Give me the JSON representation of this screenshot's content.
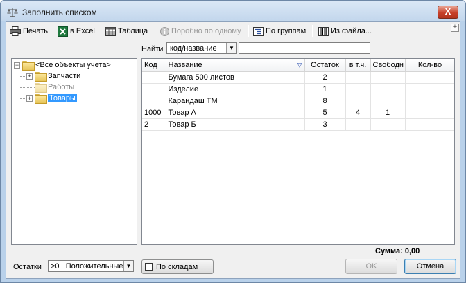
{
  "window": {
    "title": "Заполнить списком",
    "close_glyph": "X"
  },
  "toolbar": {
    "print": "Печать",
    "excel": "в Excel",
    "table": "Таблица",
    "one_by_one": "Поробно по одному",
    "by_groups": "По группам",
    "from_file": "Из файла...",
    "plus_glyph": "+"
  },
  "find": {
    "label": "Найти",
    "mode": "код/название",
    "value": ""
  },
  "tree": {
    "root": "<Все объекты учета>",
    "items": [
      {
        "label": "Запчасти"
      },
      {
        "label": "Работы"
      },
      {
        "label": "Товары"
      }
    ]
  },
  "grid": {
    "columns": [
      "Код",
      "Название",
      "Остаток",
      "в т.ч.",
      "Свободн",
      "Кол-во"
    ],
    "rows": [
      {
        "code": "",
        "name": "Бумага 500 листов",
        "stock": "2",
        "incl": "",
        "free": "",
        "qty": ""
      },
      {
        "code": "",
        "name": "Изделие",
        "stock": "1",
        "incl": "",
        "free": "",
        "qty": ""
      },
      {
        "code": "",
        "name": "Карандаш ТМ",
        "stock": "8",
        "incl": "",
        "free": "",
        "qty": ""
      },
      {
        "code": "1000",
        "name": "Товар А",
        "stock": "5",
        "incl": "4",
        "free": "1",
        "qty": ""
      },
      {
        "code": "2",
        "name": "Товар Б",
        "stock": "3",
        "incl": "",
        "free": "",
        "qty": ""
      }
    ]
  },
  "footer": {
    "sum": "Сумма: 0,00",
    "remains_label": "Остатки",
    "remains_value": ">0   Положительные",
    "by_stores": "По складам",
    "ok": "OK",
    "cancel": "Отмена"
  },
  "colors": {
    "selection": "#3399ff",
    "title_bar": "#c2d6ec",
    "close_button": "#c7402a"
  }
}
